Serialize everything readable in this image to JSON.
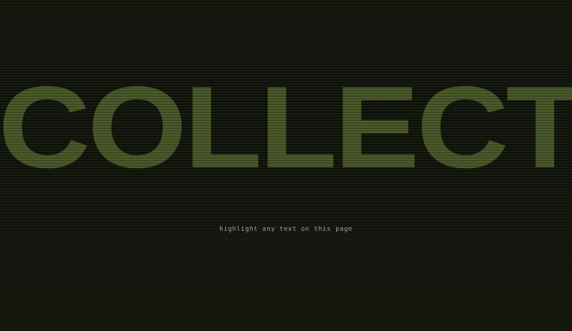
{
  "hero": {
    "word": "COLLECT"
  },
  "hint": {
    "text": "highlight any text on this page"
  },
  "colors": {
    "background": "#171a10",
    "hero_text": "#4b5a2b",
    "hint_text": "#b9b9b9"
  }
}
